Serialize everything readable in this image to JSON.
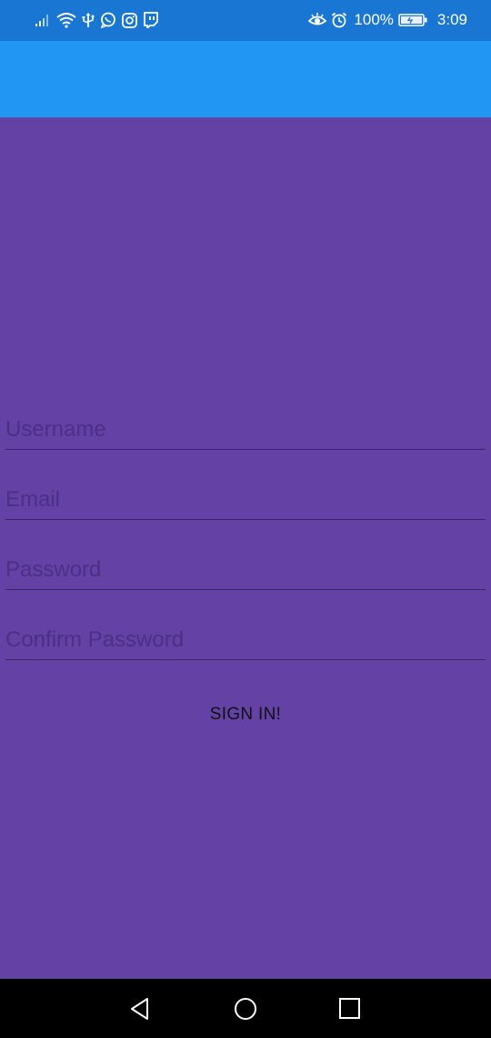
{
  "status_bar": {
    "battery_percent": "100%",
    "time": "3:09",
    "left_icons": [
      "signal-icon",
      "wifi-icon",
      "usb-icon",
      "whatsapp-icon",
      "instagram-icon",
      "twitch-icon"
    ],
    "right_icons": [
      "eye-comfort-icon",
      "alarm-icon",
      "battery-icon"
    ]
  },
  "colors": {
    "status_bar": "#1976D2",
    "app_bar": "#2196F3",
    "background": "#6441A5",
    "nav_bar": "#000000"
  },
  "form": {
    "username_placeholder": "Username",
    "email_placeholder": "Email",
    "password_placeholder": "Password",
    "confirm_password_placeholder": "Confirm Password",
    "submit_label": "SIGN IN!"
  },
  "nav_bar": {
    "icons": [
      "back-icon",
      "home-icon",
      "recents-icon"
    ]
  }
}
